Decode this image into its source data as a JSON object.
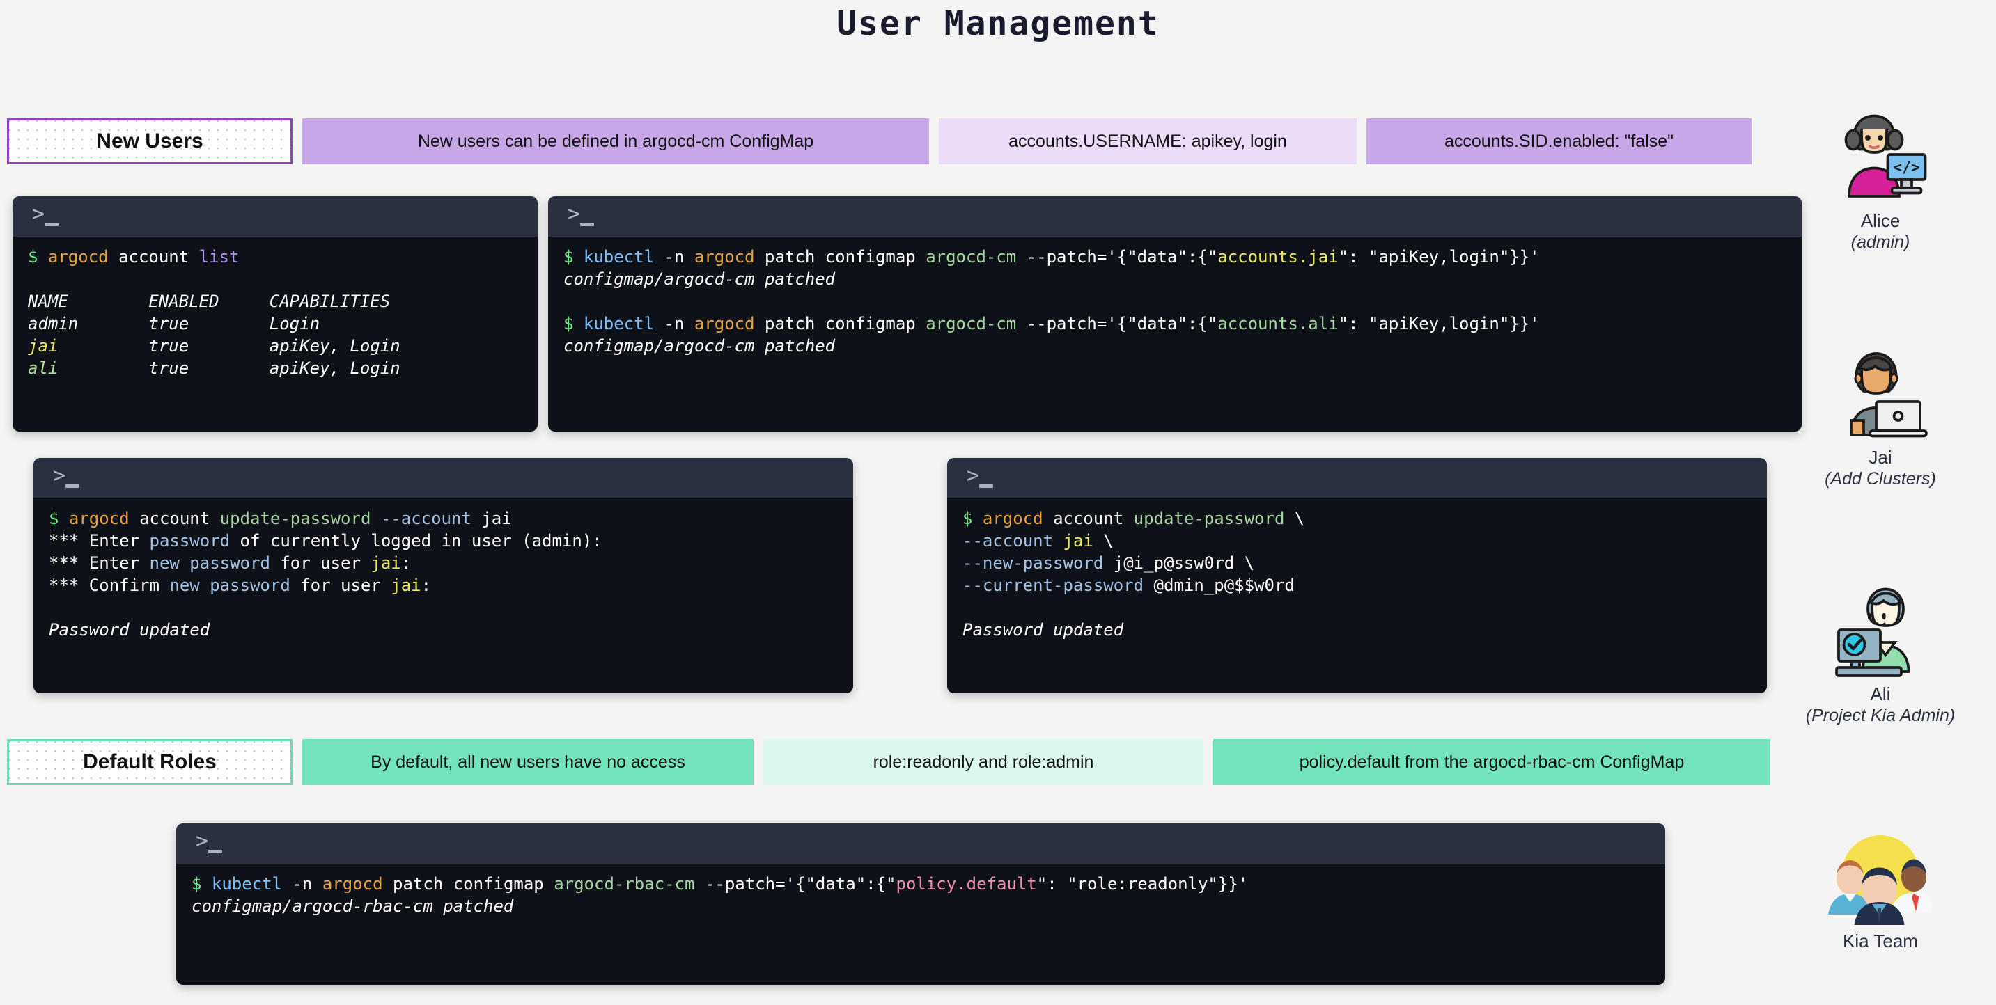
{
  "page": {
    "title": "User Management"
  },
  "sections": {
    "new_users": {
      "label": "New Users",
      "chips": [
        "New users can be defined in argocd-cm ConfigMap",
        "accounts.USERNAME: apikey, login",
        "accounts.SID.enabled: \"false\""
      ],
      "accent": "#8e44c7"
    },
    "default_roles": {
      "label": "Default Roles",
      "chips": [
        "By default, all new users have no access",
        "role:readonly and role:admin",
        "policy.default from the argocd-rbac-cm ConfigMap"
      ],
      "accent": "#6fdcb4"
    }
  },
  "terminals": {
    "account_list": {
      "prompt_icon": "terminal-prompt-icon",
      "lines": [
        {
          "segments": [
            {
              "t": "$ ",
              "c": "dollar"
            },
            {
              "t": "argocd ",
              "c": "cmd-orange"
            },
            {
              "t": "account ",
              "c": "cmd-white"
            },
            {
              "t": "list",
              "c": "cmd-purple"
            }
          ]
        },
        {
          "segments": [],
          "blank": true
        },
        {
          "italic": true,
          "segments": [
            {
              "t": "NAME        ENABLED     CAPABILITIES",
              "c": "cmd-white"
            }
          ]
        },
        {
          "italic": true,
          "segments": [
            {
              "t": "admin       true        Login",
              "c": "cmd-white"
            }
          ]
        },
        {
          "italic": true,
          "segments": [
            {
              "t": "jai",
              "c": "cmd-yellow"
            },
            {
              "t": "         true        apiKey, Login",
              "c": "cmd-white"
            }
          ]
        },
        {
          "italic": true,
          "segments": [
            {
              "t": "ali",
              "c": "cmd-ltgreen"
            },
            {
              "t": "         true        apiKey, Login",
              "c": "cmd-white"
            }
          ]
        }
      ]
    },
    "patch_accounts": {
      "lines": [
        {
          "segments": [
            {
              "t": "$ ",
              "c": "dollar"
            },
            {
              "t": "kubectl ",
              "c": "cmd-cyan"
            },
            {
              "t": "-n ",
              "c": "cmd-white"
            },
            {
              "t": "argocd ",
              "c": "cmd-orange"
            },
            {
              "t": "patch configmap ",
              "c": "cmd-white"
            },
            {
              "t": "argocd-cm ",
              "c": "cmd-green"
            },
            {
              "t": "--patch='{\"data\":{\"",
              "c": "cmd-white"
            },
            {
              "t": "accounts.jai",
              "c": "cmd-yellow"
            },
            {
              "t": "\": \"apiKey,login\"}}'",
              "c": "cmd-white"
            }
          ]
        },
        {
          "italic": true,
          "segments": [
            {
              "t": "configmap/argocd-cm patched",
              "c": "cmd-white"
            }
          ]
        },
        {
          "segments": [],
          "blank": true
        },
        {
          "segments": [
            {
              "t": "$ ",
              "c": "dollar"
            },
            {
              "t": "kubectl ",
              "c": "cmd-cyan"
            },
            {
              "t": "-n ",
              "c": "cmd-white"
            },
            {
              "t": "argocd ",
              "c": "cmd-orange"
            },
            {
              "t": "patch configmap ",
              "c": "cmd-white"
            },
            {
              "t": "argocd-cm ",
              "c": "cmd-green"
            },
            {
              "t": "--patch='{\"data\":{\"",
              "c": "cmd-white"
            },
            {
              "t": "accounts.ali",
              "c": "cmd-green"
            },
            {
              "t": "\": \"apiKey,login\"}}'",
              "c": "cmd-white"
            }
          ]
        },
        {
          "italic": true,
          "segments": [
            {
              "t": "configmap/argocd-cm patched",
              "c": "cmd-white"
            }
          ]
        }
      ]
    },
    "update_password_interactive": {
      "lines": [
        {
          "segments": [
            {
              "t": "$ ",
              "c": "dollar"
            },
            {
              "t": "argocd ",
              "c": "cmd-orange"
            },
            {
              "t": "account ",
              "c": "cmd-white"
            },
            {
              "t": "update-password ",
              "c": "cmd-green"
            },
            {
              "t": "--account ",
              "c": "cmd-blue2"
            },
            {
              "t": "jai",
              "c": "cmd-white"
            }
          ]
        },
        {
          "segments": [
            {
              "t": "*** Enter ",
              "c": "cmd-white"
            },
            {
              "t": "password ",
              "c": "cmd-blue2"
            },
            {
              "t": "of currently logged in user (admin):",
              "c": "cmd-white"
            }
          ]
        },
        {
          "segments": [
            {
              "t": "*** Enter ",
              "c": "cmd-white"
            },
            {
              "t": "new password ",
              "c": "cmd-blue2"
            },
            {
              "t": "for user ",
              "c": "cmd-white"
            },
            {
              "t": "jai",
              "c": "cmd-yellow"
            },
            {
              "t": ":",
              "c": "cmd-white"
            }
          ]
        },
        {
          "segments": [
            {
              "t": "*** Confirm ",
              "c": "cmd-white"
            },
            {
              "t": "new password ",
              "c": "cmd-blue2"
            },
            {
              "t": "for user ",
              "c": "cmd-white"
            },
            {
              "t": "jai",
              "c": "cmd-yellow"
            },
            {
              "t": ":",
              "c": "cmd-white"
            }
          ]
        },
        {
          "segments": [],
          "blank": true
        },
        {
          "italic": true,
          "segments": [
            {
              "t": "Password updated",
              "c": "cmd-white"
            }
          ]
        }
      ]
    },
    "update_password_flags": {
      "lines": [
        {
          "segments": [
            {
              "t": "$ ",
              "c": "dollar"
            },
            {
              "t": "argocd ",
              "c": "cmd-orange"
            },
            {
              "t": "account ",
              "c": "cmd-white"
            },
            {
              "t": "update-password ",
              "c": "cmd-green"
            },
            {
              "t": "\\",
              "c": "cmd-white"
            }
          ]
        },
        {
          "segments": [
            {
              "t": "--account ",
              "c": "cmd-blue2"
            },
            {
              "t": "jai",
              "c": "cmd-yellow"
            },
            {
              "t": " \\",
              "c": "cmd-white"
            }
          ]
        },
        {
          "segments": [
            {
              "t": "--new-password ",
              "c": "cmd-blue2"
            },
            {
              "t": "j@i_p@ssw0rd \\",
              "c": "cmd-white"
            }
          ]
        },
        {
          "segments": [
            {
              "t": "--current-password ",
              "c": "cmd-blue2"
            },
            {
              "t": "@dmin_p@$$w0rd",
              "c": "cmd-white"
            }
          ]
        },
        {
          "segments": [],
          "blank": true
        },
        {
          "italic": true,
          "segments": [
            {
              "t": "Password updated",
              "c": "cmd-white"
            }
          ]
        }
      ]
    },
    "patch_rbac": {
      "lines": [
        {
          "segments": [
            {
              "t": "$ ",
              "c": "dollar"
            },
            {
              "t": "kubectl ",
              "c": "cmd-cyan"
            },
            {
              "t": "-n ",
              "c": "cmd-white"
            },
            {
              "t": "argocd ",
              "c": "cmd-orange"
            },
            {
              "t": "patch configmap ",
              "c": "cmd-white"
            },
            {
              "t": "argocd-rbac-cm ",
              "c": "cmd-green"
            },
            {
              "t": "--patch='{\"data\":{\"",
              "c": "cmd-white"
            },
            {
              "t": "policy.default",
              "c": "cmd-pink"
            },
            {
              "t": "\": \"role:readonly\"}}'",
              "c": "cmd-white"
            }
          ]
        },
        {
          "italic": true,
          "segments": [
            {
              "t": "configmap/argocd-rbac-cm patched",
              "c": "cmd-white"
            }
          ]
        }
      ]
    }
  },
  "personas": [
    {
      "icon": "woman-technologist-avatar",
      "name": "Alice",
      "role": "(admin)"
    },
    {
      "icon": "man-with-laptop-avatar",
      "name": "Jai",
      "role": "(Add Clusters)"
    },
    {
      "icon": "person-with-verified-monitor-avatar",
      "name": "Ali",
      "role": "(Project Kia Admin)"
    },
    {
      "icon": "team-group-avatar",
      "name": "Kia Team",
      "role": ""
    }
  ]
}
